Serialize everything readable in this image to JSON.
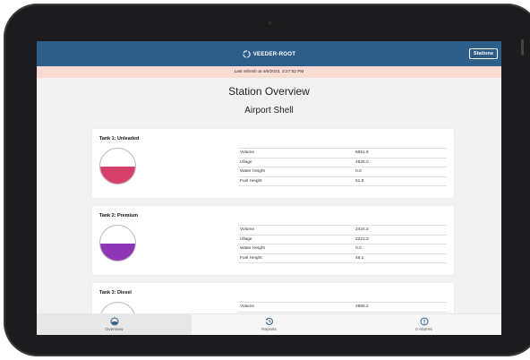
{
  "header": {
    "brand": "VEEDER-ROOT",
    "stations_label": "Stations",
    "accent": "#2f5d8a"
  },
  "refresh": {
    "text": "Last refresh at 4/6/2023, 3:27:52 PM"
  },
  "main": {
    "title": "Station Overview",
    "site": "Airport Shell",
    "tanks": [
      {
        "name": "Tank 1: Unleaded",
        "fill_color": "#d6406a",
        "fill_fraction": 0.5,
        "metrics": [
          {
            "label": "Volume",
            "value": "6851.6"
          },
          {
            "label": "Ullage",
            "value": "4525.0"
          },
          {
            "label": "Water Height",
            "value": "0.0"
          },
          {
            "label": "Fuel Height",
            "value": "51.8"
          }
        ]
      },
      {
        "name": "Tank 2: Premium",
        "fill_color": "#8e36b5",
        "fill_fraction": 0.5,
        "metrics": [
          {
            "label": "Volume",
            "value": "2424.2"
          },
          {
            "label": "Ullage",
            "value": "2221.3"
          },
          {
            "label": "Water Height",
            "value": "0.0"
          },
          {
            "label": "Fuel Height",
            "value": "46.1"
          }
        ]
      },
      {
        "name": "Tank 3: Diesel",
        "fill_color": "#ffffff",
        "fill_fraction": 0,
        "metrics": [
          {
            "label": "Volume",
            "value": "2986.2"
          }
        ]
      }
    ]
  },
  "tabs": [
    {
      "label": "Overview",
      "icon": "gauge-icon",
      "active": true
    },
    {
      "label": "Reports",
      "icon": "history-icon",
      "active": false
    },
    {
      "label": "0 Alarms",
      "icon": "alert-icon",
      "active": false
    }
  ]
}
